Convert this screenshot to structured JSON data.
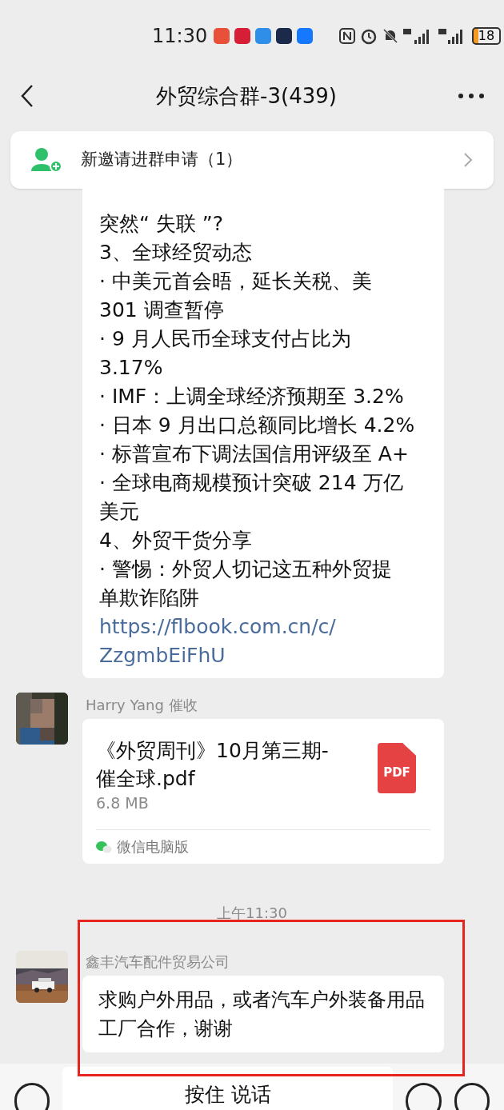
{
  "status_bar": {
    "time": "11:30",
    "battery": "18"
  },
  "header": {
    "title": "外贸综合群-3(439)"
  },
  "banner": {
    "text": "新邀请进群申请（1）"
  },
  "messages": [
    {
      "kind": "text_lines",
      "lines": [
        {
          "kind": "text",
          "text": "突然“ 失联 ”?"
        },
        {
          "kind": "text",
          "text": "3、全球经贸动态"
        },
        {
          "kind": "text",
          "text": "· 中美元首会晤，延长关税、美"
        },
        {
          "kind": "text",
          "text": "301 调查暂停"
        },
        {
          "kind": "text",
          "text": "· 9 月人民币全球支付占比为"
        },
        {
          "kind": "text",
          "text": "3.17%"
        },
        {
          "kind": "text",
          "text": "· IMF：上调全球经济预期至 3.2%"
        },
        {
          "kind": "text",
          "text": "· 日本 9 月出口总额同比增长 4.2%"
        },
        {
          "kind": "text",
          "text": "· 标普宣布下调法国信用评级至 A+"
        },
        {
          "kind": "text",
          "text": "· 全球电商规模预计突破 214 万亿"
        },
        {
          "kind": "text",
          "text": "美元"
        },
        {
          "kind": "text",
          "text": "4、外贸干货分享"
        },
        {
          "kind": "text",
          "text": "· 警惕：外贸人切记这五种外贸提"
        },
        {
          "kind": "text",
          "text": "单欺诈陷阱"
        },
        {
          "kind": "link",
          "text": "https://flbook.com.cn/c/"
        },
        {
          "kind": "link",
          "text": "ZzgmbEiFhU"
        }
      ]
    },
    {
      "kind": "file",
      "sender": "Harry Yang 催收",
      "file_name": "《外贸周刊》10月第三期-催全球.pdf",
      "file_type": "PDF",
      "size": "6.8 MB",
      "source": "微信电脑版"
    },
    {
      "kind": "time",
      "text": "上午11:30"
    },
    {
      "kind": "text",
      "sender": "鑫丰汽车配件贸易公司",
      "text": "求购户外用品，或者汽车户外装备用品工厂合作，谢谢",
      "highlighted": true
    }
  ],
  "input_bar": {
    "hold_to_talk": "按住 说话"
  }
}
